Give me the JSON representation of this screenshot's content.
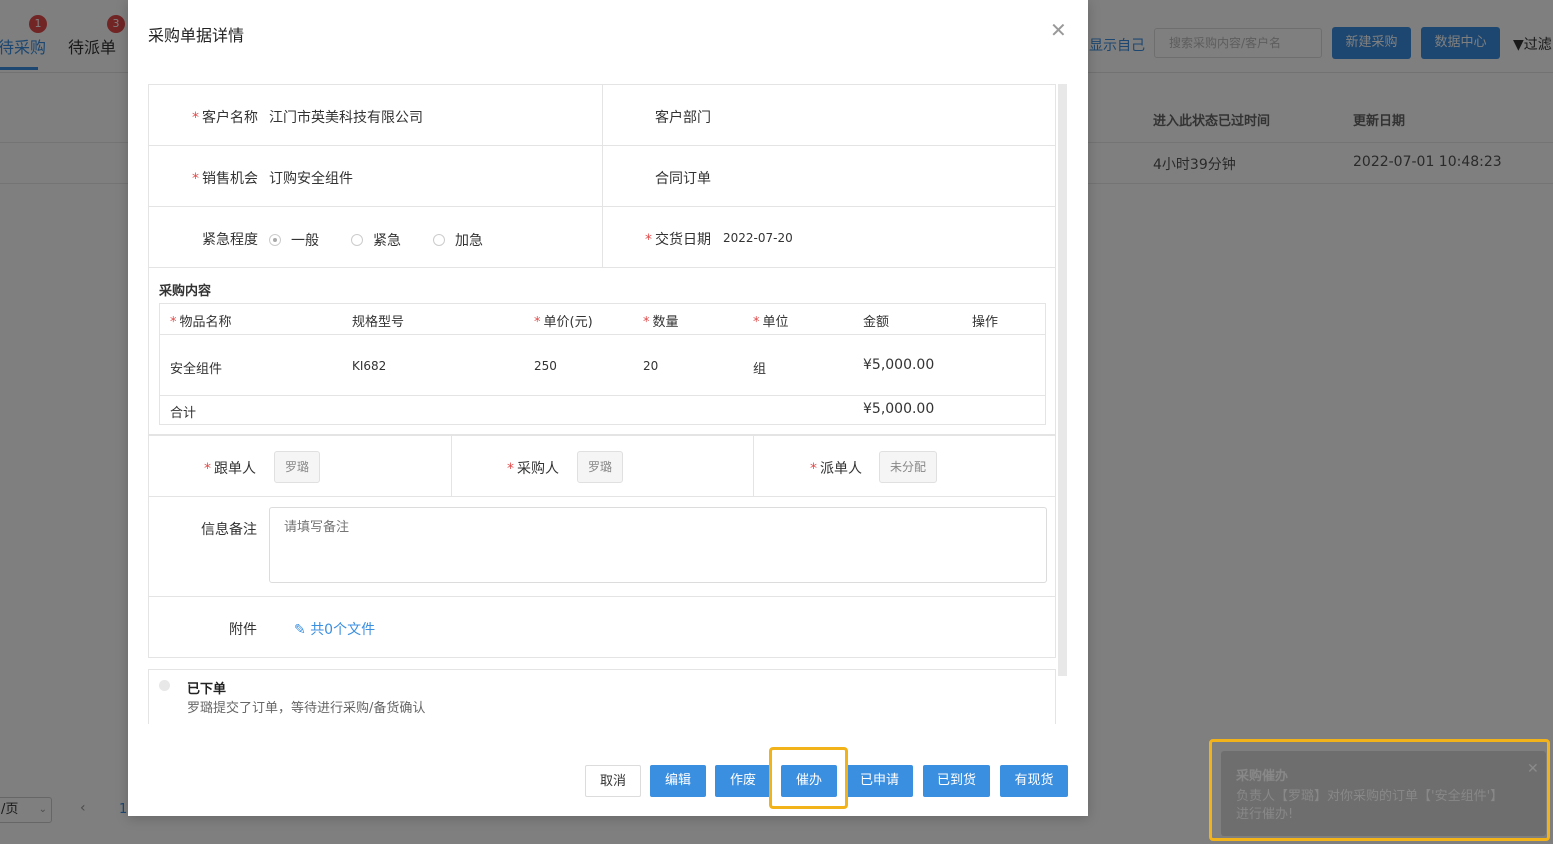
{
  "background": {
    "tabs": [
      {
        "label": "待采购",
        "badge": "1"
      },
      {
        "label": "待派单",
        "badge": "3"
      }
    ],
    "show_self_label": "显示自己",
    "search_placeholder": "搜索采购内容/客户名",
    "new_purchase_label": "新建采购",
    "data_center_label": "数据中心",
    "filter_label": "过滤",
    "table_headers": {
      "elapsed": "进入此状态已过时间",
      "updated": "更新日期"
    },
    "row": {
      "elapsed": "4小时39分钟",
      "updated": "2022-07-01 10:48:23"
    },
    "pager": {
      "page_size": "/页",
      "current_page": "1"
    }
  },
  "modal": {
    "title": "采购单据详情",
    "fields": {
      "customer_name_label": "客户名称",
      "customer_name": "江门市英美科技有限公司",
      "customer_dept_label": "客户部门",
      "sales_opp_label": "销售机会",
      "sales_opp": "订购安全组件",
      "contract_label": "合同订单",
      "urgency_label": "紧急程度",
      "urgency_options": [
        "一般",
        "紧急",
        "加急"
      ],
      "urgency_selected": "一般",
      "delivery_label": "交货日期",
      "delivery_date": "2022-07-20"
    },
    "purchase": {
      "section_label": "采购内容",
      "headers": {
        "item": "物品名称",
        "spec": "规格型号",
        "price": "单价(元)",
        "qty": "数量",
        "unit": "单位",
        "amount": "金额",
        "action": "操作"
      },
      "rows": [
        {
          "item": "安全组件",
          "spec": "KI682",
          "price": "250",
          "qty": "20",
          "unit": "组",
          "amount": "¥5,000.00"
        }
      ],
      "total_label": "合计",
      "total_amount": "¥5,000.00"
    },
    "people": {
      "follower_label": "跟单人",
      "follower": "罗璐",
      "buyer_label": "采购人",
      "buyer": "罗璐",
      "dispatcher_label": "派单人",
      "dispatcher": "未分配"
    },
    "remark_label": "信息备注",
    "remark_placeholder": "请填写备注",
    "attachment_label": "附件",
    "attachment_link": "共0个文件",
    "timeline": {
      "title": "已下单",
      "desc": "罗璐提交了订单，等待进行采购/备货确认"
    },
    "buttons": {
      "cancel": "取消",
      "edit": "编辑",
      "void": "作废",
      "urge": "催办",
      "applied": "已申请",
      "arrived": "已到货",
      "in_stock": "有现货"
    },
    "highlight_color": "#f2b31a"
  },
  "toast": {
    "title": "采购催办",
    "message": "负责人【罗璐】对你采购的订单【'安全组件'】进行催办!"
  },
  "colors": {
    "primary": "#3b8fe0",
    "required": "#e24a4a"
  }
}
